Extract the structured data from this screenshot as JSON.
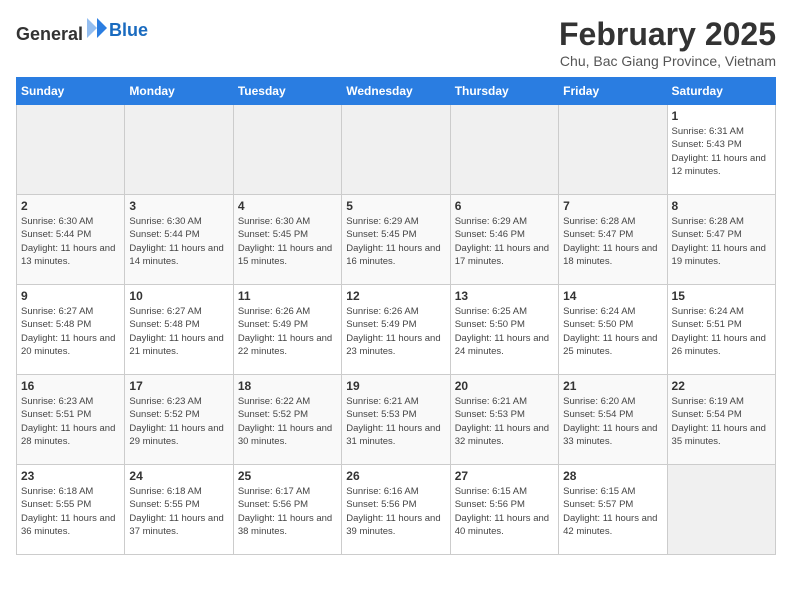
{
  "header": {
    "logo_general": "General",
    "logo_blue": "Blue",
    "title": "February 2025",
    "subtitle": "Chu, Bac Giang Province, Vietnam"
  },
  "days_of_week": [
    "Sunday",
    "Monday",
    "Tuesday",
    "Wednesday",
    "Thursday",
    "Friday",
    "Saturday"
  ],
  "weeks": [
    [
      {
        "day": "",
        "info": ""
      },
      {
        "day": "",
        "info": ""
      },
      {
        "day": "",
        "info": ""
      },
      {
        "day": "",
        "info": ""
      },
      {
        "day": "",
        "info": ""
      },
      {
        "day": "",
        "info": ""
      },
      {
        "day": "1",
        "info": "Sunrise: 6:31 AM\nSunset: 5:43 PM\nDaylight: 11 hours and 12 minutes."
      }
    ],
    [
      {
        "day": "2",
        "info": "Sunrise: 6:30 AM\nSunset: 5:44 PM\nDaylight: 11 hours and 13 minutes."
      },
      {
        "day": "3",
        "info": "Sunrise: 6:30 AM\nSunset: 5:44 PM\nDaylight: 11 hours and 14 minutes."
      },
      {
        "day": "4",
        "info": "Sunrise: 6:30 AM\nSunset: 5:45 PM\nDaylight: 11 hours and 15 minutes."
      },
      {
        "day": "5",
        "info": "Sunrise: 6:29 AM\nSunset: 5:45 PM\nDaylight: 11 hours and 16 minutes."
      },
      {
        "day": "6",
        "info": "Sunrise: 6:29 AM\nSunset: 5:46 PM\nDaylight: 11 hours and 17 minutes."
      },
      {
        "day": "7",
        "info": "Sunrise: 6:28 AM\nSunset: 5:47 PM\nDaylight: 11 hours and 18 minutes."
      },
      {
        "day": "8",
        "info": "Sunrise: 6:28 AM\nSunset: 5:47 PM\nDaylight: 11 hours and 19 minutes."
      }
    ],
    [
      {
        "day": "9",
        "info": "Sunrise: 6:27 AM\nSunset: 5:48 PM\nDaylight: 11 hours and 20 minutes."
      },
      {
        "day": "10",
        "info": "Sunrise: 6:27 AM\nSunset: 5:48 PM\nDaylight: 11 hours and 21 minutes."
      },
      {
        "day": "11",
        "info": "Sunrise: 6:26 AM\nSunset: 5:49 PM\nDaylight: 11 hours and 22 minutes."
      },
      {
        "day": "12",
        "info": "Sunrise: 6:26 AM\nSunset: 5:49 PM\nDaylight: 11 hours and 23 minutes."
      },
      {
        "day": "13",
        "info": "Sunrise: 6:25 AM\nSunset: 5:50 PM\nDaylight: 11 hours and 24 minutes."
      },
      {
        "day": "14",
        "info": "Sunrise: 6:24 AM\nSunset: 5:50 PM\nDaylight: 11 hours and 25 minutes."
      },
      {
        "day": "15",
        "info": "Sunrise: 6:24 AM\nSunset: 5:51 PM\nDaylight: 11 hours and 26 minutes."
      }
    ],
    [
      {
        "day": "16",
        "info": "Sunrise: 6:23 AM\nSunset: 5:51 PM\nDaylight: 11 hours and 28 minutes."
      },
      {
        "day": "17",
        "info": "Sunrise: 6:23 AM\nSunset: 5:52 PM\nDaylight: 11 hours and 29 minutes."
      },
      {
        "day": "18",
        "info": "Sunrise: 6:22 AM\nSunset: 5:52 PM\nDaylight: 11 hours and 30 minutes."
      },
      {
        "day": "19",
        "info": "Sunrise: 6:21 AM\nSunset: 5:53 PM\nDaylight: 11 hours and 31 minutes."
      },
      {
        "day": "20",
        "info": "Sunrise: 6:21 AM\nSunset: 5:53 PM\nDaylight: 11 hours and 32 minutes."
      },
      {
        "day": "21",
        "info": "Sunrise: 6:20 AM\nSunset: 5:54 PM\nDaylight: 11 hours and 33 minutes."
      },
      {
        "day": "22",
        "info": "Sunrise: 6:19 AM\nSunset: 5:54 PM\nDaylight: 11 hours and 35 minutes."
      }
    ],
    [
      {
        "day": "23",
        "info": "Sunrise: 6:18 AM\nSunset: 5:55 PM\nDaylight: 11 hours and 36 minutes."
      },
      {
        "day": "24",
        "info": "Sunrise: 6:18 AM\nSunset: 5:55 PM\nDaylight: 11 hours and 37 minutes."
      },
      {
        "day": "25",
        "info": "Sunrise: 6:17 AM\nSunset: 5:56 PM\nDaylight: 11 hours and 38 minutes."
      },
      {
        "day": "26",
        "info": "Sunrise: 6:16 AM\nSunset: 5:56 PM\nDaylight: 11 hours and 39 minutes."
      },
      {
        "day": "27",
        "info": "Sunrise: 6:15 AM\nSunset: 5:56 PM\nDaylight: 11 hours and 40 minutes."
      },
      {
        "day": "28",
        "info": "Sunrise: 6:15 AM\nSunset: 5:57 PM\nDaylight: 11 hours and 42 minutes."
      },
      {
        "day": "",
        "info": ""
      }
    ]
  ]
}
